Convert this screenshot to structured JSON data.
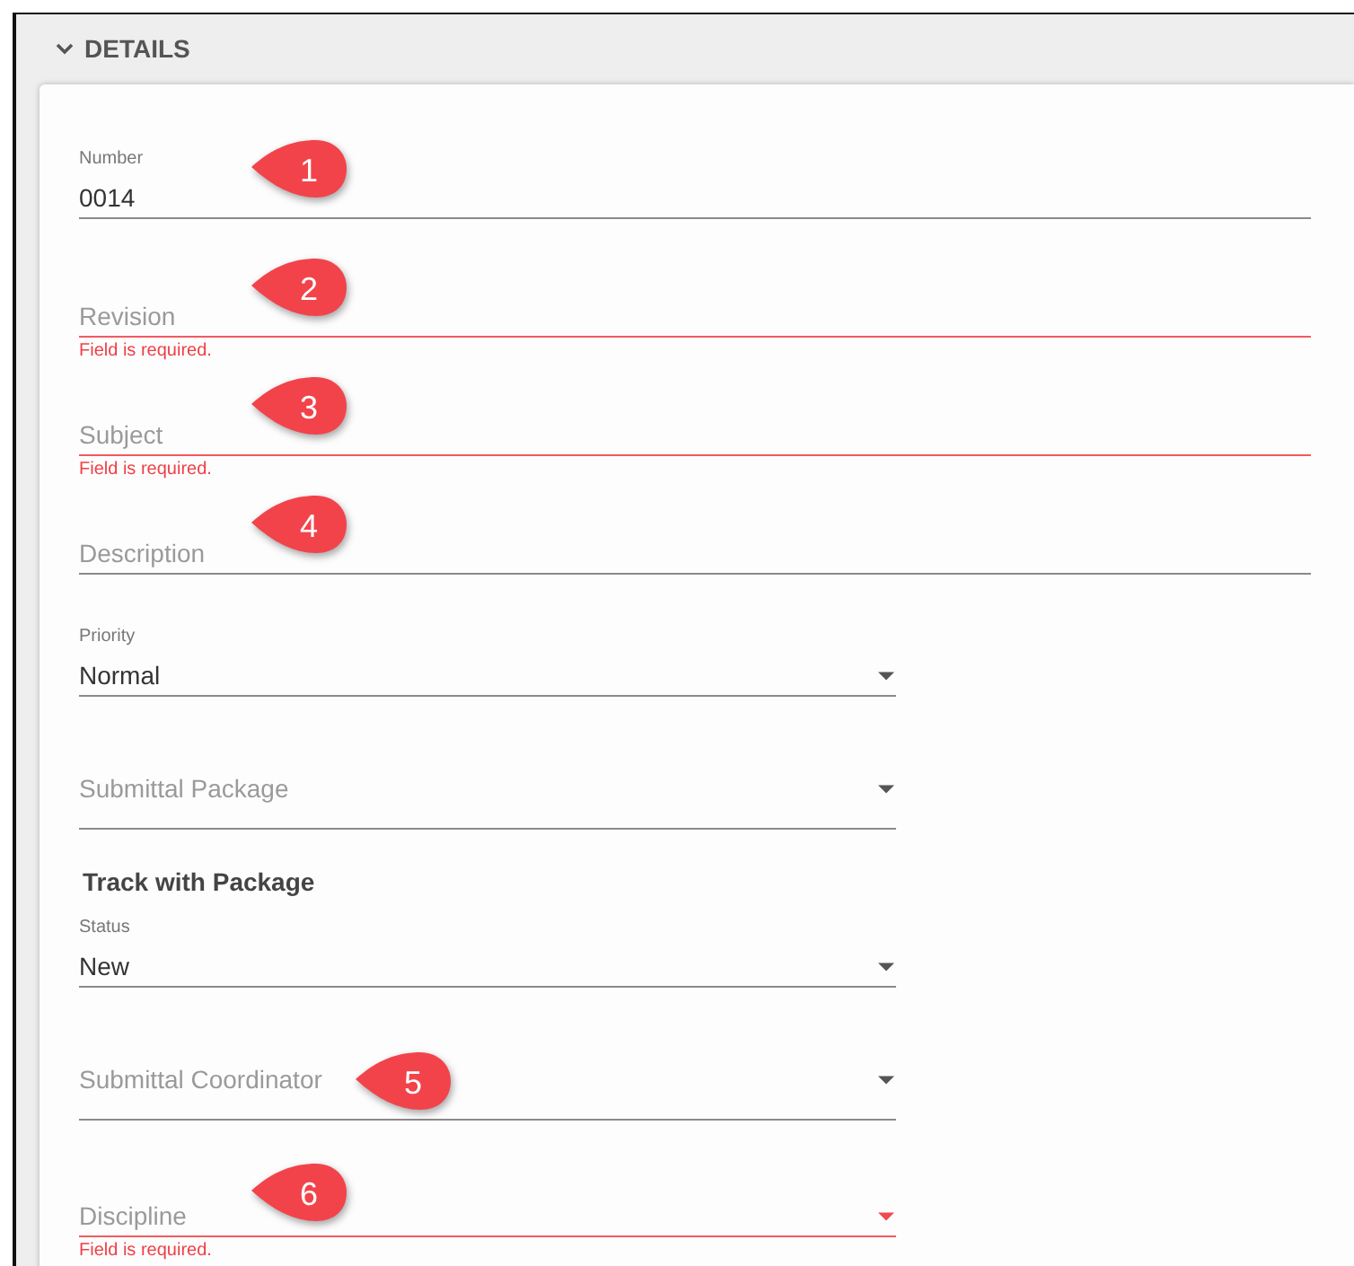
{
  "section": {
    "title": "DETAILS",
    "expanded": true
  },
  "fields": [
    {
      "kind": "text",
      "label": "Number",
      "value": "0014",
      "callout": "1"
    },
    {
      "kind": "text",
      "placeholder": "Revision",
      "error": "Field is required.",
      "callout": "2"
    },
    {
      "kind": "text",
      "placeholder": "Subject",
      "error": "Field is required.",
      "callout": "3"
    },
    {
      "kind": "text",
      "placeholder": "Description",
      "callout": "4"
    },
    {
      "kind": "select",
      "label": "Priority",
      "value": "Normal"
    },
    {
      "kind": "select",
      "placeholder": "Submittal Package"
    },
    {
      "kind": "heading",
      "text": "Track with Package"
    },
    {
      "kind": "select",
      "label": "Status",
      "value": "New"
    },
    {
      "kind": "select",
      "placeholder": "Submittal Coordinator",
      "callout": "5"
    },
    {
      "kind": "select",
      "placeholder": "Discipline",
      "error": "Field is required.",
      "callout": "6"
    }
  ]
}
